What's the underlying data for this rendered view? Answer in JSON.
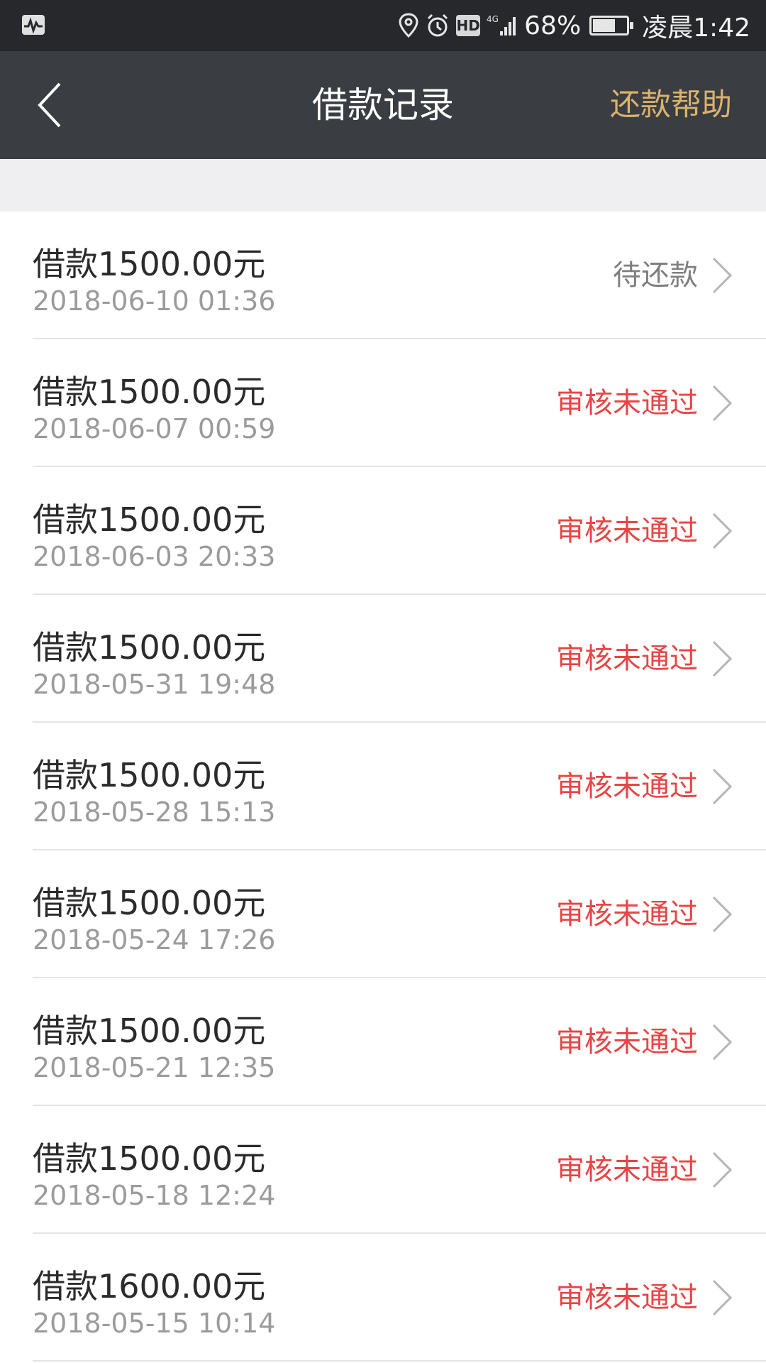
{
  "status_bar": {
    "battery_percent": "68%",
    "battery_level": 0.68,
    "time": "凌晨1:42",
    "network": "4G",
    "hd": "HD"
  },
  "nav": {
    "title": "借款记录",
    "help_label": "还款帮助"
  },
  "colors": {
    "nav_bg": "#3a3d42",
    "status_bg": "#26282b",
    "accent_gold": "#d9b36c",
    "rejected_red": "#e84545",
    "pending_gray": "#7f7f7f"
  },
  "records": [
    {
      "amount": "借款1500.00元",
      "datetime": "2018-06-10 01:36",
      "status": "待还款",
      "status_type": "pending"
    },
    {
      "amount": "借款1500.00元",
      "datetime": "2018-06-07 00:59",
      "status": "审核未通过",
      "status_type": "rejected"
    },
    {
      "amount": "借款1500.00元",
      "datetime": "2018-06-03 20:33",
      "status": "审核未通过",
      "status_type": "rejected"
    },
    {
      "amount": "借款1500.00元",
      "datetime": "2018-05-31 19:48",
      "status": "审核未通过",
      "status_type": "rejected"
    },
    {
      "amount": "借款1500.00元",
      "datetime": "2018-05-28 15:13",
      "status": "审核未通过",
      "status_type": "rejected"
    },
    {
      "amount": "借款1500.00元",
      "datetime": "2018-05-24 17:26",
      "status": "审核未通过",
      "status_type": "rejected"
    },
    {
      "amount": "借款1500.00元",
      "datetime": "2018-05-21 12:35",
      "status": "审核未通过",
      "status_type": "rejected"
    },
    {
      "amount": "借款1500.00元",
      "datetime": "2018-05-18 12:24",
      "status": "审核未通过",
      "status_type": "rejected"
    },
    {
      "amount": "借款1600.00元",
      "datetime": "2018-05-15 10:14",
      "status": "审核未通过",
      "status_type": "rejected"
    }
  ]
}
